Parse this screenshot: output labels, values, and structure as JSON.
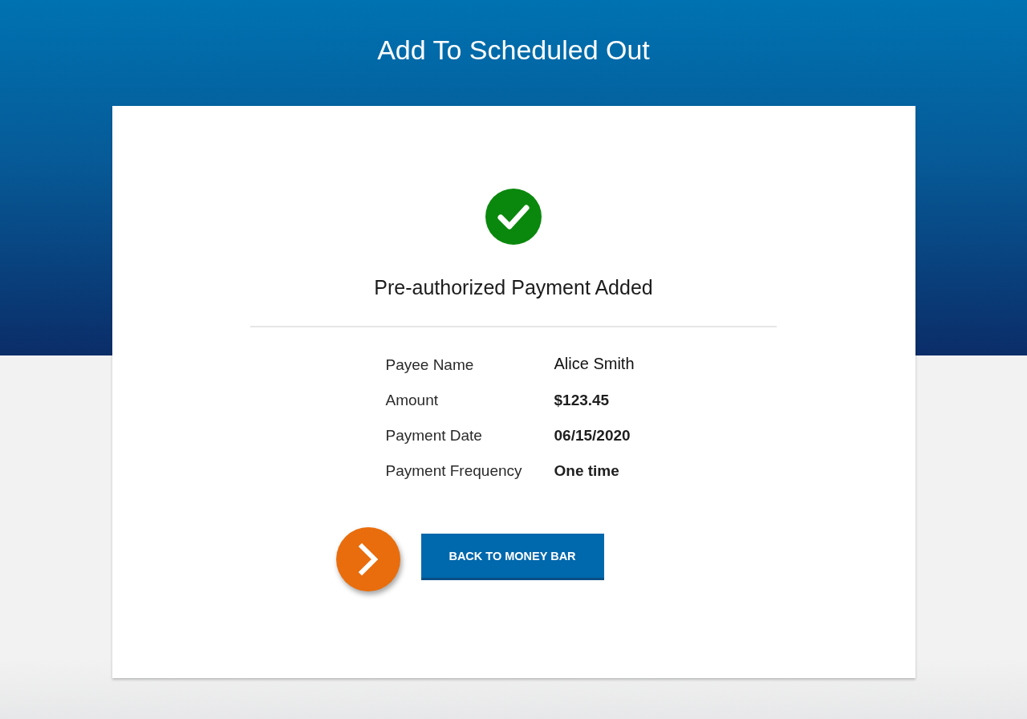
{
  "page": {
    "title": "Add To Scheduled Out"
  },
  "confirmation": {
    "heading": "Pre-authorized Payment Added"
  },
  "details": [
    {
      "label": "Payee Name",
      "value": "Alice Smith",
      "kind": "plain"
    },
    {
      "label": "Amount",
      "value": "$123.45",
      "kind": "strong"
    },
    {
      "label": "Payment Date",
      "value": "06/15/2020",
      "kind": "strong"
    },
    {
      "label": "Payment Frequency",
      "value": "One time",
      "kind": "strong"
    }
  ],
  "actions": {
    "button": "BACK TO MONEY BAR"
  }
}
